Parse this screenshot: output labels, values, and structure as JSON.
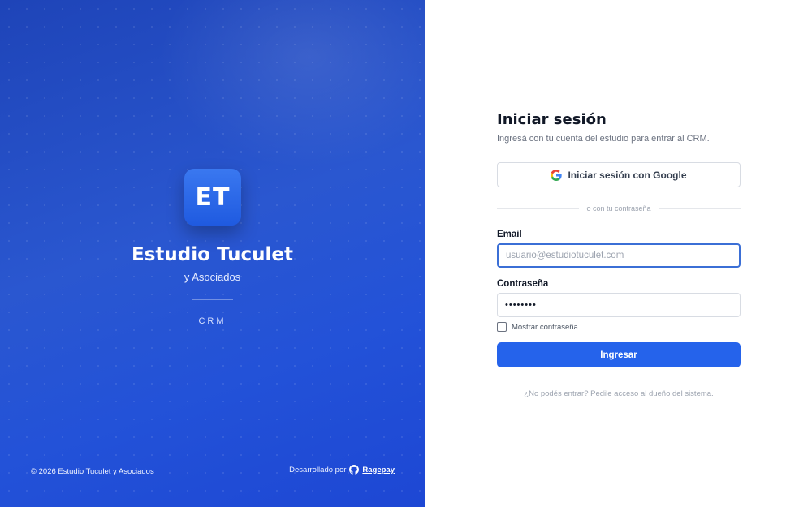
{
  "brand": {
    "logo_text": "ET",
    "name": "Estudio Tuculet",
    "subtitle": "y Asociados",
    "tag": "CRM"
  },
  "footer": {
    "copyright": "© 2026 Estudio Tuculet y Asociados",
    "developed_by": "Desarrollado por",
    "developer": "Ragepay",
    "developer_icon": "github-icon"
  },
  "login": {
    "title": "Iniciar sesión",
    "subtitle": "Ingresá con tu cuenta del estudio para entrar al CRM.",
    "google_button": "Iniciar sesión con Google",
    "google_icon": "google-icon",
    "divider_text": "o con tu contraseña",
    "email_label": "Email",
    "email_placeholder": "usuario@estudiotuculet.com",
    "email_value": "",
    "password_label": "Contraseña",
    "password_value": "••••••••",
    "show_password_label": "Mostrar contraseña",
    "show_password_checked": false,
    "submit_button": "Ingresar",
    "help_text": "¿No podés entrar? Pedile acceso al dueño del sistema."
  },
  "colors": {
    "primary": "#2563eb",
    "panel_blue": "#2352d8",
    "focus_border": "#3b6fd6"
  }
}
